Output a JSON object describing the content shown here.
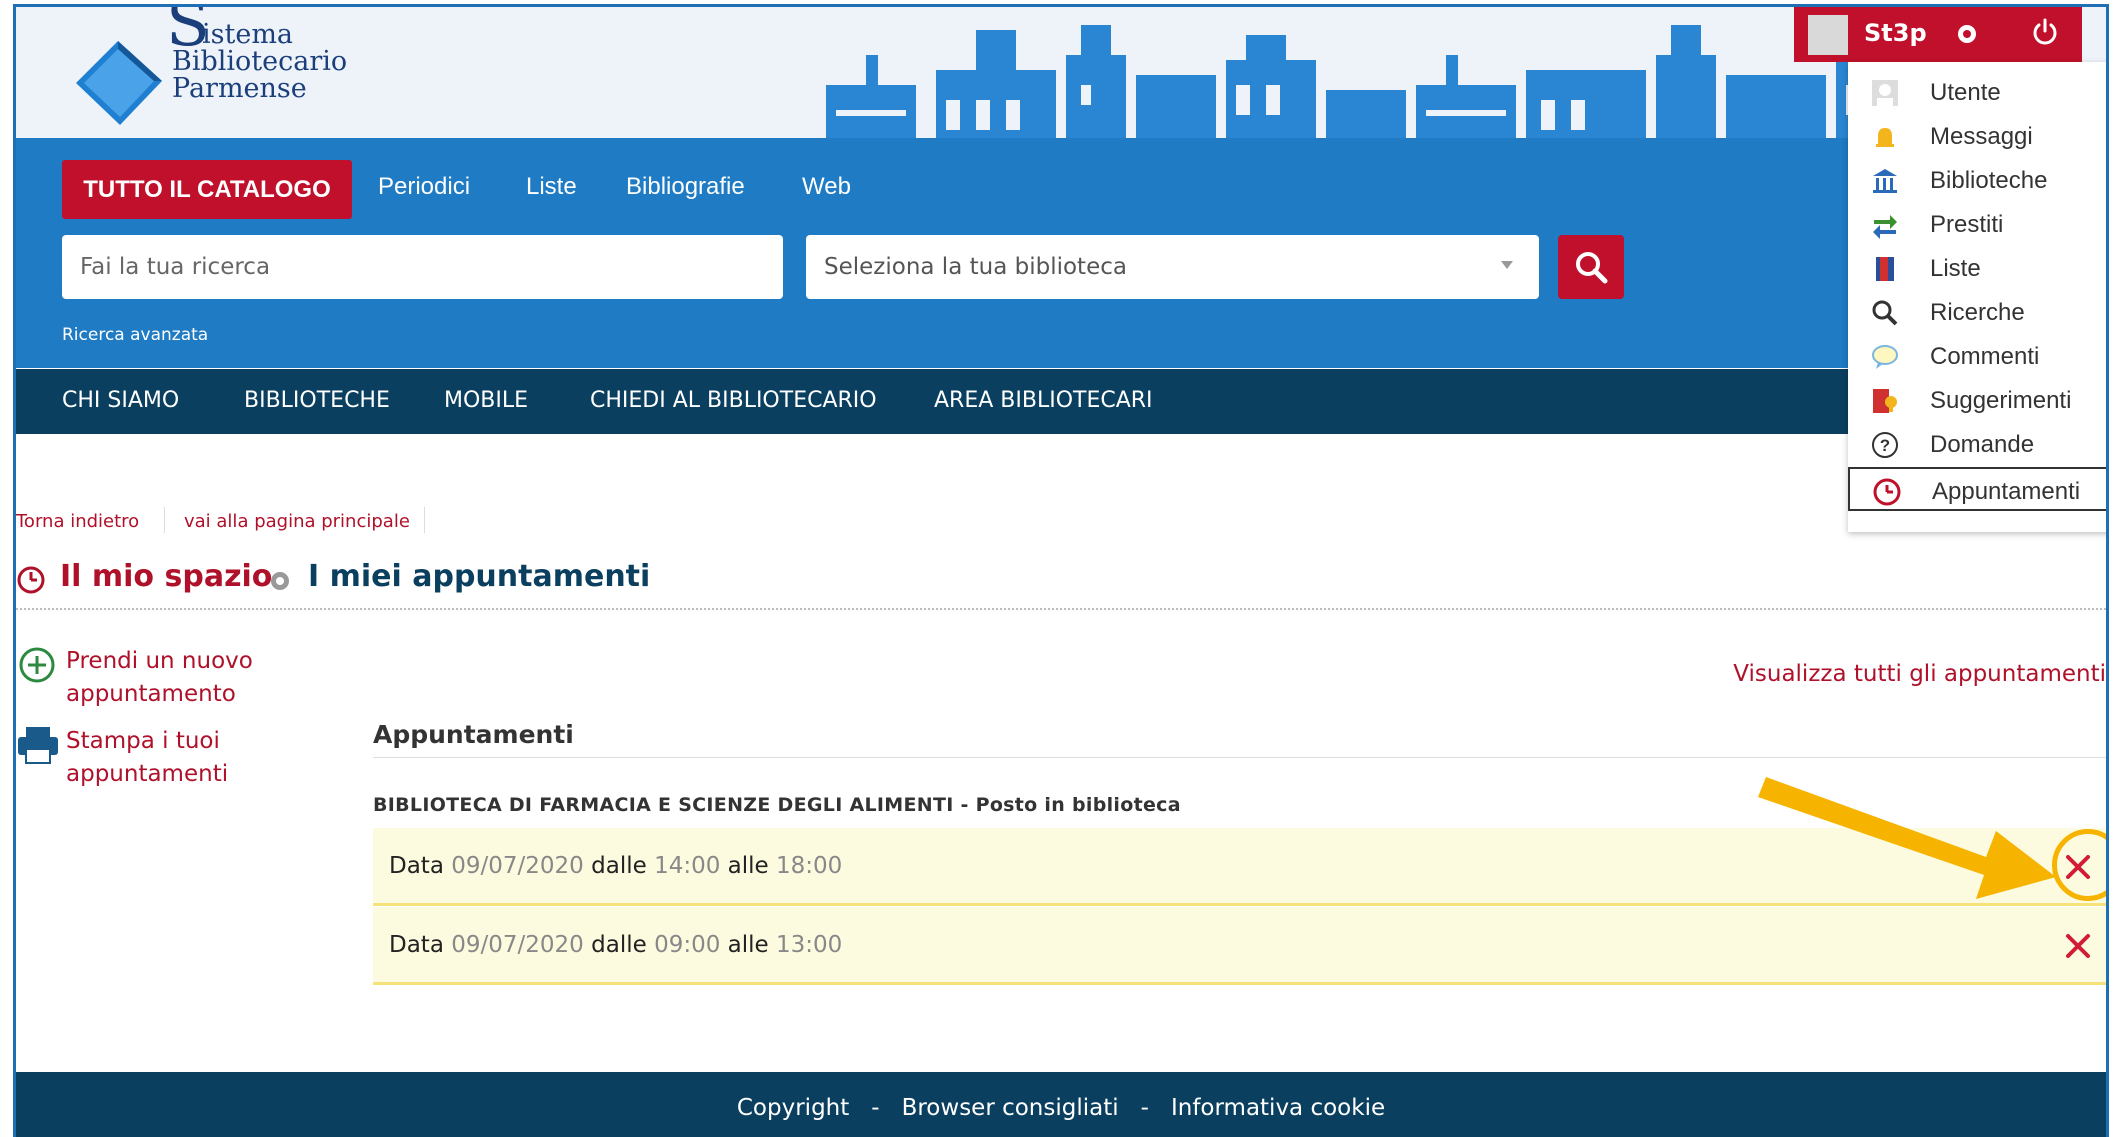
{
  "header": {
    "logo": {
      "line1": "istema",
      "letter": "S",
      "line2": "Bibliotecario",
      "line3": "Parmense"
    },
    "tabs": [
      "TUTTO IL CATALOGO",
      "Periodici",
      "Liste",
      "Bibliografie",
      "Web"
    ],
    "search_placeholder": "Fai la tua ricerca",
    "library_placeholder": "Seleziona la tua biblioteca",
    "advanced_search": "Ricerca avanzata"
  },
  "nav": [
    "CHI SIAMO",
    "BIBLIOTECHE",
    "MOBILE",
    "CHIEDI AL BIBLIOTECARIO",
    "AREA BIBLIOTECARI"
  ],
  "user": {
    "name": "St3p",
    "menu": [
      {
        "label": "Utente",
        "icon": "user-icon"
      },
      {
        "label": "Messaggi",
        "icon": "bell-icon"
      },
      {
        "label": "Biblioteche",
        "icon": "library-icon"
      },
      {
        "label": "Prestiti",
        "icon": "loan-arrows-icon"
      },
      {
        "label": "Liste",
        "icon": "list-book-icon"
      },
      {
        "label": "Ricerche",
        "icon": "search-icon"
      },
      {
        "label": "Commenti",
        "icon": "comment-icon"
      },
      {
        "label": "Suggerimenti",
        "icon": "suggestion-icon"
      },
      {
        "label": "Domande",
        "icon": "question-icon"
      },
      {
        "label": "Appuntamenti",
        "icon": "clock-icon"
      }
    ],
    "active_item": "Appuntamenti"
  },
  "breadcrumb": [
    "Torna indietro",
    "vai alla pagina principale"
  ],
  "page": {
    "title": "Il mio spazio",
    "subtitle": "I miei appuntamenti"
  },
  "sidebar": {
    "new_appointment": "Prendi un nuovo appuntamento",
    "print": "Stampa i tuoi appuntamenti"
  },
  "appointments": {
    "view_all": "Visualizza tutti gli appuntamenti",
    "heading": "Appuntamenti",
    "library": "BIBLIOTECA DI FARMACIA E SCIENZE DEGLI ALIMENTI - Posto in biblioteca",
    "labels": {
      "date": "Data",
      "from": "dalle",
      "to": "alle"
    },
    "items": [
      {
        "date": "09/07/2020",
        "from": "14:00",
        "to": "18:00"
      },
      {
        "date": "09/07/2020",
        "from": "09:00",
        "to": "13:00"
      }
    ]
  },
  "footer": {
    "links": [
      "Copyright",
      "Browser consigliati",
      "Informativa cookie"
    ],
    "separator": "-"
  },
  "colors": {
    "brand_red": "#c0102b",
    "brand_blue": "#1e7bc4",
    "dark_navy": "#0b3f5f",
    "highlight": "#f6b400"
  }
}
